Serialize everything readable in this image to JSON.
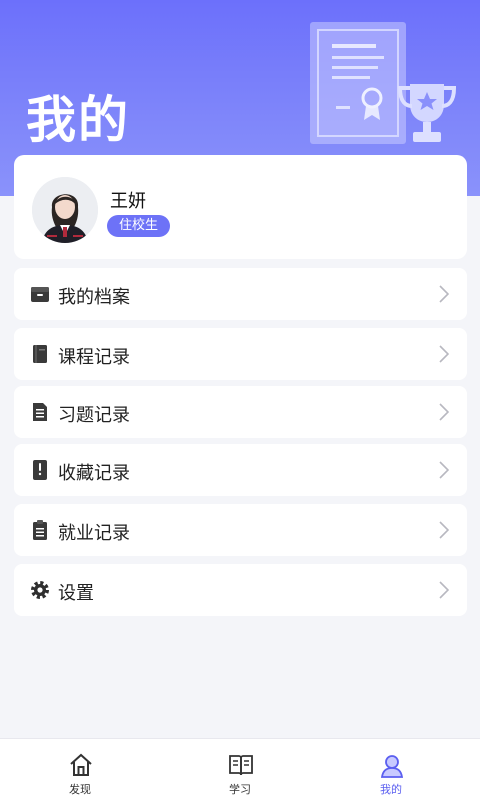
{
  "header": {
    "title": "我的"
  },
  "profile": {
    "name": "王妍",
    "badge": "住校生"
  },
  "menu": [
    {
      "label": "我的档案",
      "icon": "archive-box-icon"
    },
    {
      "label": "课程记录",
      "icon": "book-icon"
    },
    {
      "label": "习题记录",
      "icon": "document-list-icon"
    },
    {
      "label": "收藏记录",
      "icon": "bookmark-icon"
    },
    {
      "label": "就业记录",
      "icon": "clipboard-icon"
    },
    {
      "label": "设置",
      "icon": "gear-icon"
    }
  ],
  "tabs": [
    {
      "label": "发现",
      "icon": "home-icon",
      "active": false
    },
    {
      "label": "学习",
      "icon": "open-book-icon",
      "active": false
    },
    {
      "label": "我的",
      "icon": "user-icon",
      "active": true
    }
  ],
  "colors": {
    "accent": "#6c70fb",
    "badge": "#6d72f7",
    "active_tab": "#5b5ff0",
    "background": "#f4f5f9"
  }
}
